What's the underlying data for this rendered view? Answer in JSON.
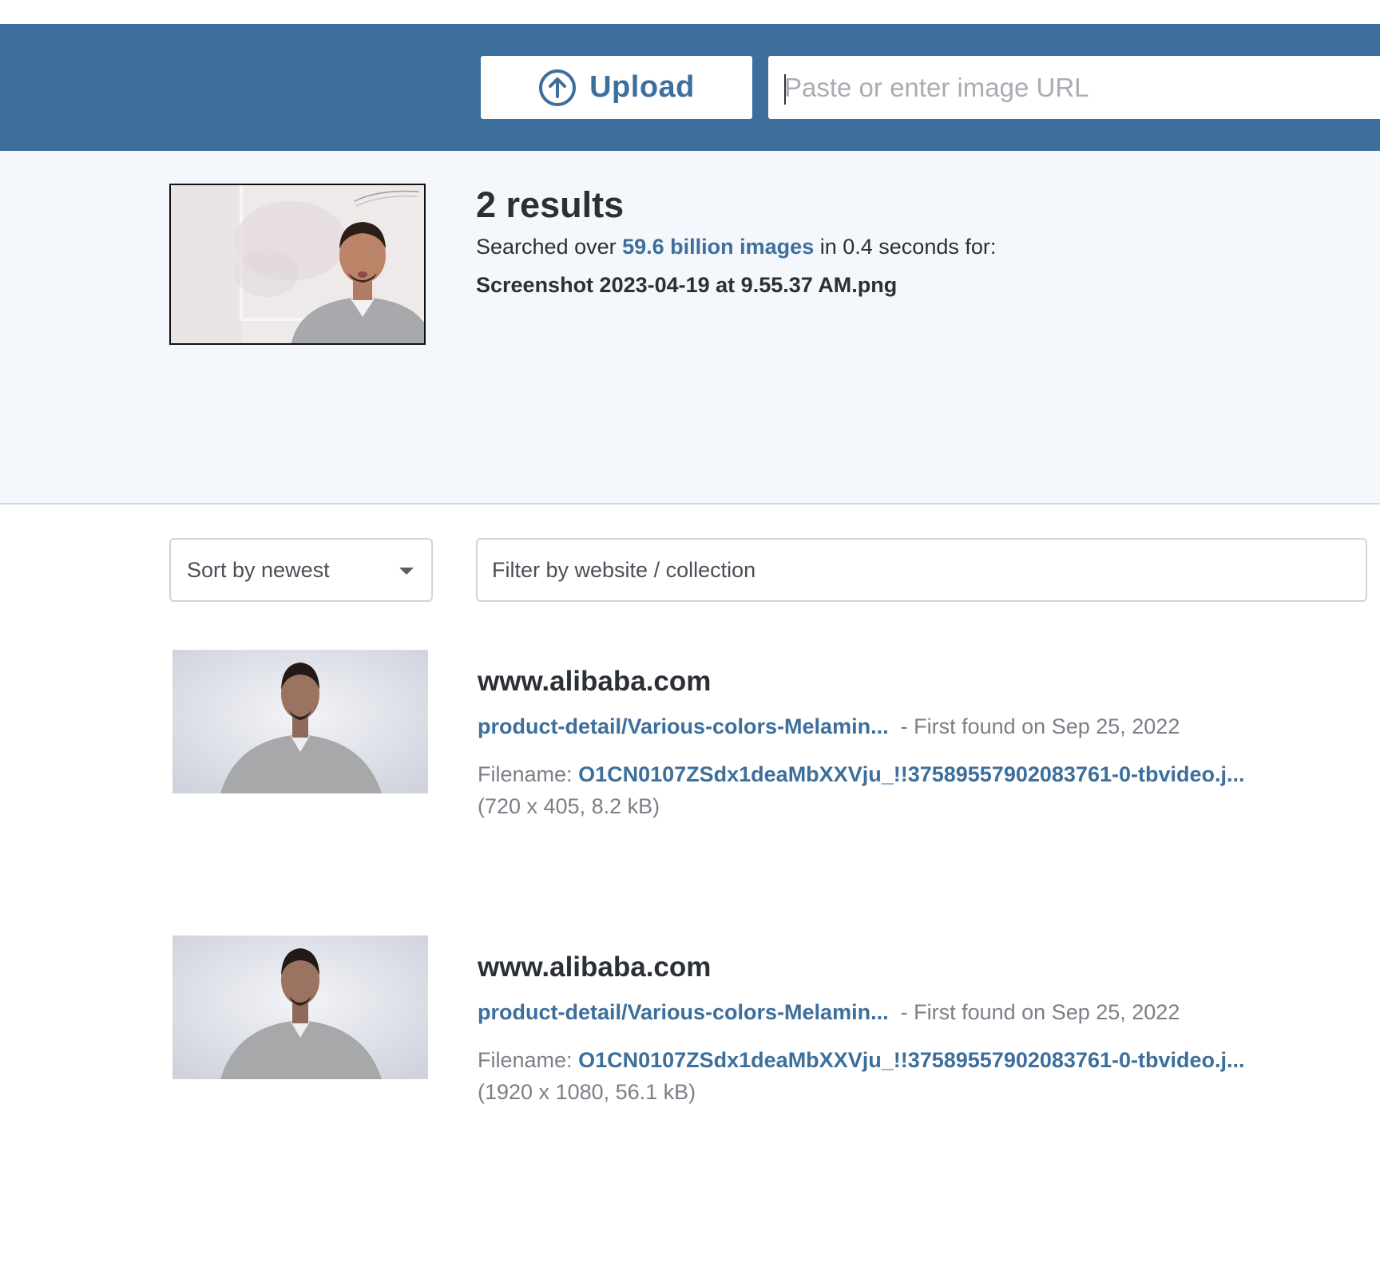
{
  "header": {
    "upload_label": "Upload",
    "url_placeholder": "Paste or enter image URL"
  },
  "query": {
    "results_count": "2 results",
    "searched_prefix": "Searched over",
    "searched_link": "59.6 billion images",
    "searched_suffix": "in 0.4 seconds for:",
    "filename": "Screenshot 2023-04-19 at 9.55.37 AM.png"
  },
  "controls": {
    "sort_label": "Sort by newest",
    "filter_placeholder": "Filter by website / collection"
  },
  "results": [
    {
      "domain": "www.alibaba.com",
      "page_link": "product-detail/Various-colors-Melamin...",
      "found": "- First found on Sep 25, 2022",
      "filename_label": "Filename:",
      "filename": "O1CN0107ZSdx1deaMbXXVju_!!3758955790208376‌1-0-tbvideo.j...",
      "dims": "(720 x 405, 8.2 kB)"
    },
    {
      "domain": "www.alibaba.com",
      "page_link": "product-detail/Various-colors-Melamin...",
      "found": "- First found on Sep 25, 2022",
      "filename_label": "Filename:",
      "filename": "O1CN0107ZSdx1deaMbXXVju_!!3758955790208376‌1-0-tbvideo.j...",
      "dims": "(1920 x 1080, 56.1 kB)"
    }
  ],
  "colors": {
    "brand": "#3d6f9c",
    "query_bg": "#f4f8fc",
    "muted_text": "#7b7f86"
  }
}
